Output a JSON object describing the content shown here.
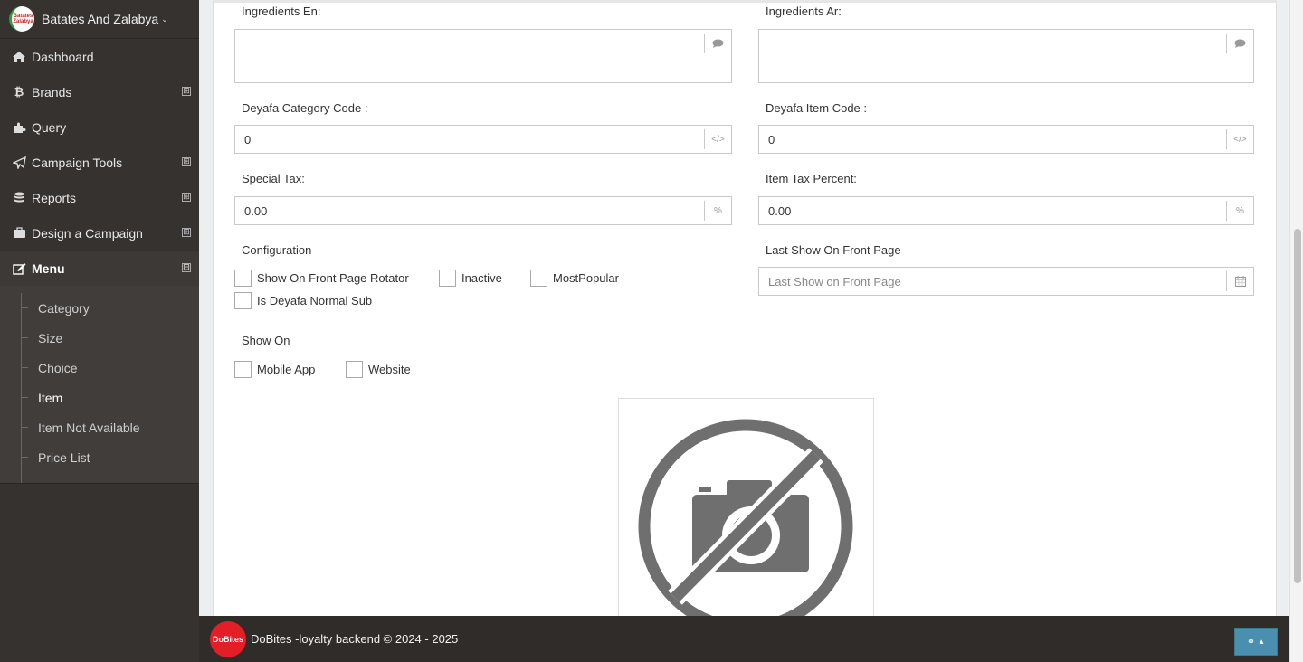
{
  "sidebar": {
    "brand": "Batates And Zalabya",
    "brand_logo_text": "Batates Zalabya",
    "items": [
      {
        "label": "Dashboard",
        "icon": "home-icon"
      },
      {
        "label": "Brands",
        "icon": "bitcoin-icon",
        "expand": "⊞"
      },
      {
        "label": "Query",
        "icon": "puzzle-icon"
      },
      {
        "label": "Campaign Tools",
        "icon": "paper-plane-icon",
        "expand": "⊞"
      },
      {
        "label": "Reports",
        "icon": "database-icon",
        "expand": "⊞"
      },
      {
        "label": "Design a Campaign",
        "icon": "briefcase-icon",
        "expand": "⊞"
      },
      {
        "label": "Menu",
        "icon": "edit-icon",
        "expand": "⊟"
      }
    ],
    "submenu": [
      "Category",
      "Size",
      "Choice",
      "Item",
      "Item Not Available",
      "Price List"
    ]
  },
  "form": {
    "ingredients_en_label": "Ingredients En:",
    "ingredients_ar_label": "Ingredients Ar:",
    "deyafa_category_label": "Deyafa Category Code :",
    "deyafa_category_value": "0",
    "deyafa_item_label": "Deyafa Item Code :",
    "deyafa_item_value": "0",
    "special_tax_label": "Special Tax:",
    "special_tax_value": "0.00",
    "item_tax_label": "Item Tax Percent:",
    "item_tax_value": "0.00",
    "percent_symbol": "%",
    "code_symbol": "</>",
    "configuration_label": "Configuration",
    "config_options": [
      "Show On Front Page Rotator",
      "Inactive",
      "MostPopular",
      "Is Deyafa Normal Sub"
    ],
    "last_show_label": "Last Show On Front Page",
    "last_show_placeholder": "Last Show on Front Page",
    "show_on_label": "Show On",
    "show_on_options": [
      "Mobile App",
      "Website"
    ]
  },
  "footer": {
    "logo_text": "DoBites",
    "text": "DoBites -loyalty backend © 2024 - 2025"
  },
  "colors": {
    "sidebar_bg": "#353230",
    "footer_bg": "#2f2c2a",
    "scroll_top_button": "#4a8fb0",
    "brand_red": "#e21f26"
  }
}
